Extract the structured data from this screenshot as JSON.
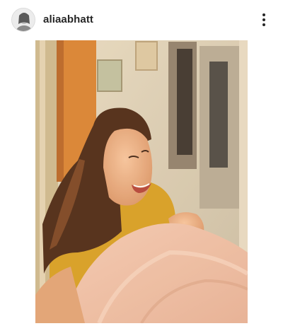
{
  "post": {
    "username": "aliaabhatt",
    "avatar_icon": "profile-avatar",
    "more_icon": "more-vertical-icon",
    "photo": {
      "description_icon": "post-photo"
    }
  },
  "colors": {
    "text": "#262626",
    "background": "#ffffff"
  }
}
